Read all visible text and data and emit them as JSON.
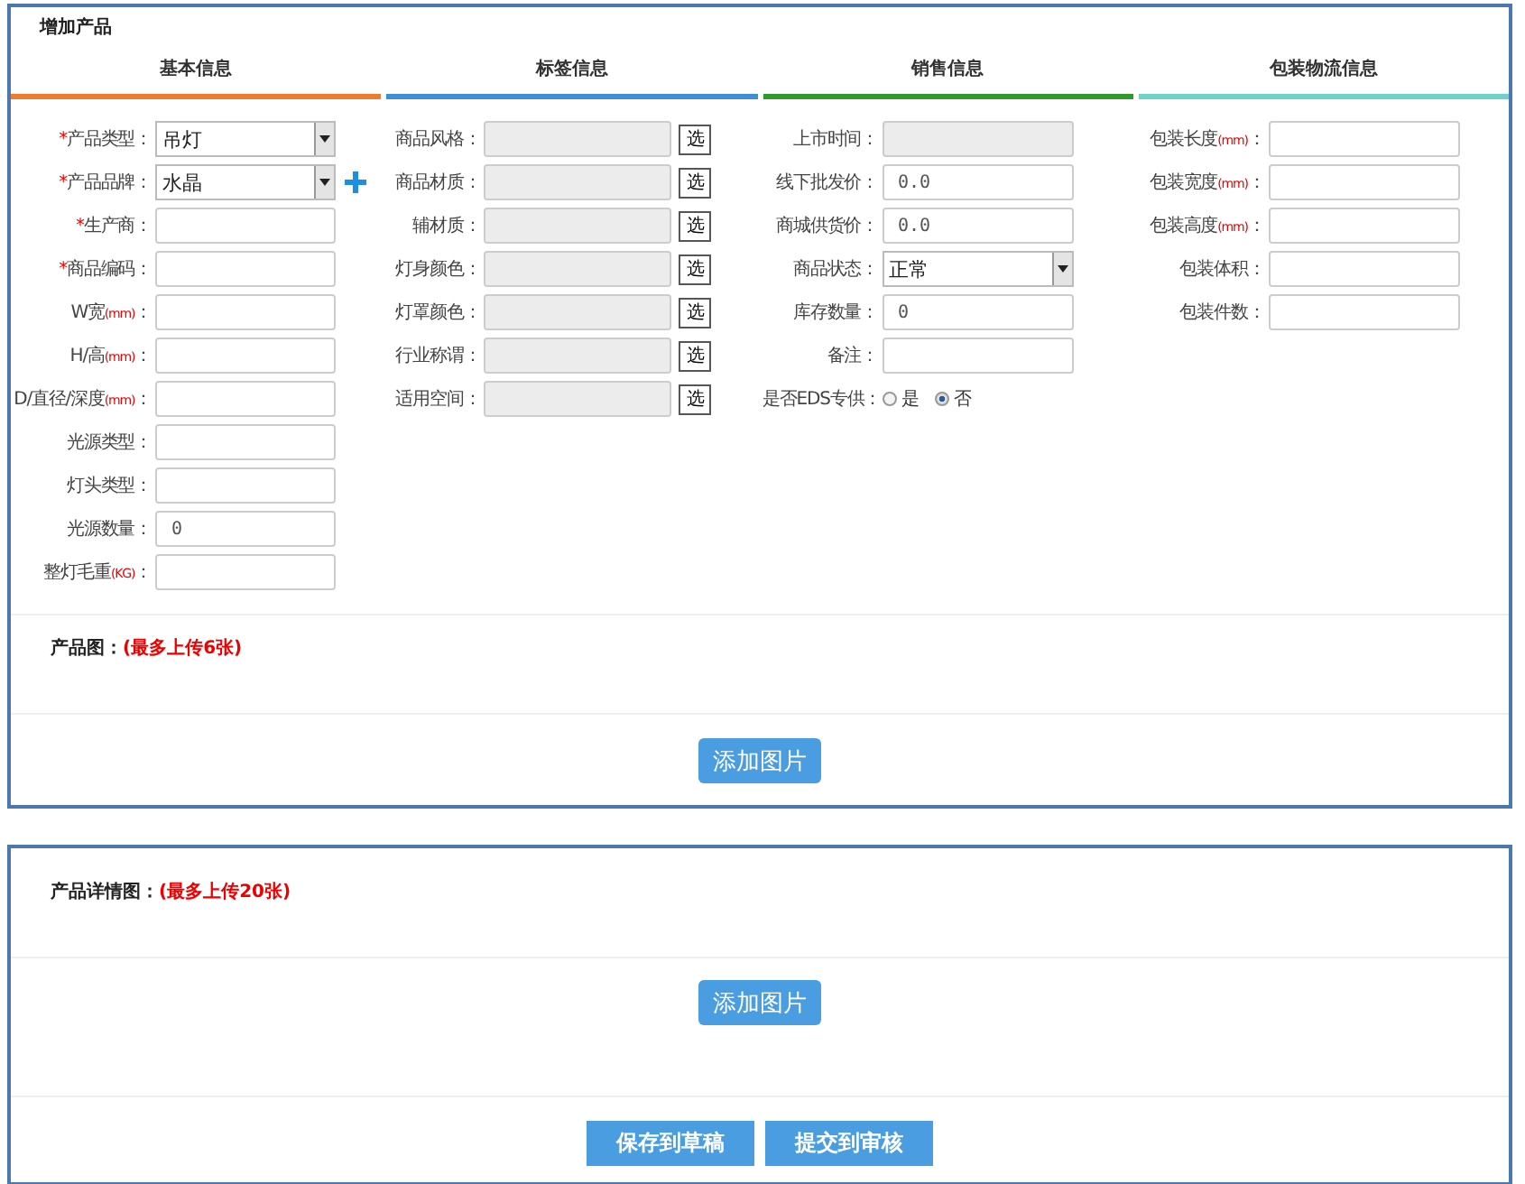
{
  "panel_title": "增加产品",
  "tabs": [
    {
      "label": "基本信息",
      "color": "#f07a2e"
    },
    {
      "label": "标签信息",
      "color": "#3c8fd8"
    },
    {
      "label": "销售信息",
      "color": "#2e9a2e"
    },
    {
      "label": "包装物流信息",
      "color": "#6fd0cc"
    }
  ],
  "columns": [
    [
      {
        "kind": "select",
        "mark": "*",
        "label": "产品类型：",
        "value": "吊灯"
      },
      {
        "kind": "select",
        "mark": "*",
        "label": "产品品牌：",
        "value": "水晶",
        "add": true
      },
      {
        "kind": "text",
        "mark": "*",
        "label": "生产商："
      },
      {
        "kind": "text",
        "mark": "*",
        "label": "商品编码："
      },
      {
        "kind": "text",
        "label": "W宽",
        "unit": "(mm)",
        "tail": "："
      },
      {
        "kind": "text",
        "label": "H/高",
        "unit": "(mm)",
        "tail": "："
      },
      {
        "kind": "text",
        "label": "D/直径/深度",
        "unit": "(mm)",
        "tail": "："
      },
      {
        "kind": "text",
        "label": "光源类型："
      },
      {
        "kind": "text",
        "label": "灯头类型："
      },
      {
        "kind": "text",
        "label": "光源数量：",
        "value": "0"
      },
      {
        "kind": "text",
        "label": "整灯毛重",
        "unit": "(KG)",
        "tail": "："
      }
    ],
    [
      {
        "kind": "picker",
        "label": "商品风格：",
        "button": "选"
      },
      {
        "kind": "picker",
        "label": "商品材质：",
        "button": "选"
      },
      {
        "kind": "picker",
        "label": "辅材质：",
        "button": "选"
      },
      {
        "kind": "picker",
        "label": "灯身颜色：",
        "button": "选"
      },
      {
        "kind": "picker",
        "label": "灯罩颜色：",
        "button": "选"
      },
      {
        "kind": "picker",
        "label": "行业称谓：",
        "button": "选"
      },
      {
        "kind": "picker",
        "label": "适用空间：",
        "button": "选"
      }
    ],
    [
      {
        "kind": "readonly",
        "label": "上市时间："
      },
      {
        "kind": "text",
        "label": "线下批发价：",
        "value": "0.0"
      },
      {
        "kind": "text",
        "label": "商城供货价：",
        "value": "0.0"
      },
      {
        "kind": "select",
        "label": "商品状态：",
        "value": "正常"
      },
      {
        "kind": "text",
        "label": "库存数量：",
        "value": "0"
      },
      {
        "kind": "text",
        "label": "备注："
      },
      {
        "kind": "radio",
        "label": "是否EDS专供：",
        "options": [
          {
            "label": "是",
            "selected": false
          },
          {
            "label": "否",
            "selected": true
          }
        ]
      }
    ],
    [
      {
        "kind": "text",
        "label": "包装长度",
        "unit": "(mm)",
        "tail": "："
      },
      {
        "kind": "text",
        "label": "包装宽度",
        "unit": "(mm)",
        "tail": "："
      },
      {
        "kind": "text",
        "label": "包装高度",
        "unit": "(mm)",
        "tail": "："
      },
      {
        "kind": "text",
        "label": "包装体积："
      },
      {
        "kind": "text",
        "label": "包装件数："
      }
    ]
  ],
  "product_images": {
    "title": "产品图：",
    "note": "(最多上传6张)",
    "button": "添加图片"
  },
  "detail_images": {
    "title": "产品详情图：",
    "note": "(最多上传20张)",
    "button": "添加图片"
  },
  "actions": [
    "保存到草稿",
    "提交到审核"
  ]
}
